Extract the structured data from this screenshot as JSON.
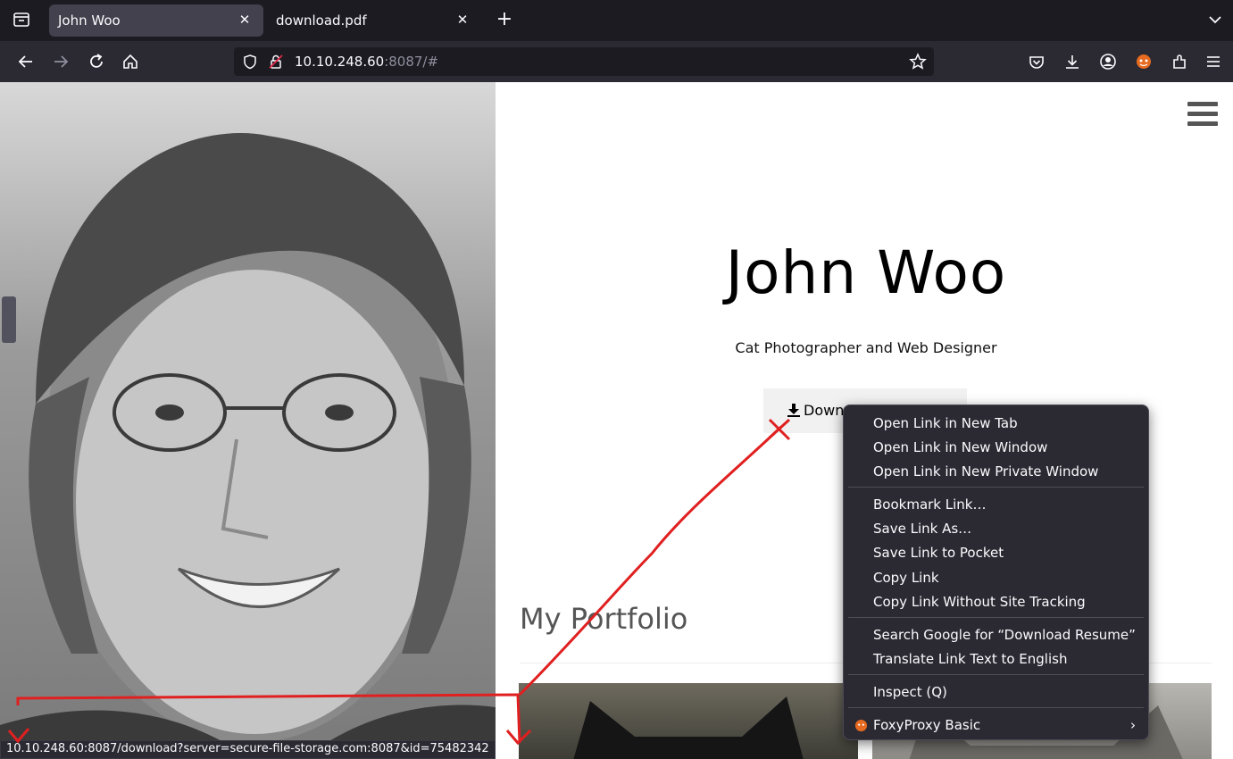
{
  "tabs": [
    {
      "title": "John Woo",
      "active": true
    },
    {
      "title": "download.pdf",
      "active": false
    }
  ],
  "urlbar": {
    "host": "10.10.248.60",
    "path": ":8087/#"
  },
  "page": {
    "title": "John Woo",
    "subtitle": "Cat Photographer and Web Designer",
    "download_button": "Down",
    "portfolio_heading": "My Portfolio"
  },
  "status_url": "10.10.248.60:8087/download?server=secure-file-storage.com:8087&id=75482342",
  "context_menu": {
    "items": [
      {
        "label": "Open Link in New Tab"
      },
      {
        "label": "Open Link in New Window"
      },
      {
        "label": "Open Link in New Private Window"
      },
      {
        "label": "Bookmark Link…"
      },
      {
        "label": "Save Link As…"
      },
      {
        "label": "Save Link to Pocket"
      },
      {
        "label": "Copy Link"
      },
      {
        "label": "Copy Link Without Site Tracking"
      },
      {
        "label": "Search Google for “Download Resume”"
      },
      {
        "label": "Translate Link Text to English"
      },
      {
        "label": "Inspect (Q)"
      },
      {
        "label": "FoxyProxy Basic"
      }
    ]
  },
  "colors": {
    "annotation": "#e02020",
    "chrome_dark": "#1c1b22",
    "toolbar": "#2b2a33",
    "active_tab": "#42414d"
  },
  "icons": [
    "tab-list-icon",
    "close-icon",
    "plus-icon",
    "chevron-down-icon",
    "back-arrow-icon",
    "forward-arrow-icon",
    "reload-icon",
    "home-icon",
    "shield-icon",
    "lock-icon",
    "star-icon",
    "pocket-icon",
    "download-icon",
    "account-icon",
    "extension-icon",
    "menu-icon",
    "foxyproxy-icon",
    "chevron-right-icon"
  ]
}
